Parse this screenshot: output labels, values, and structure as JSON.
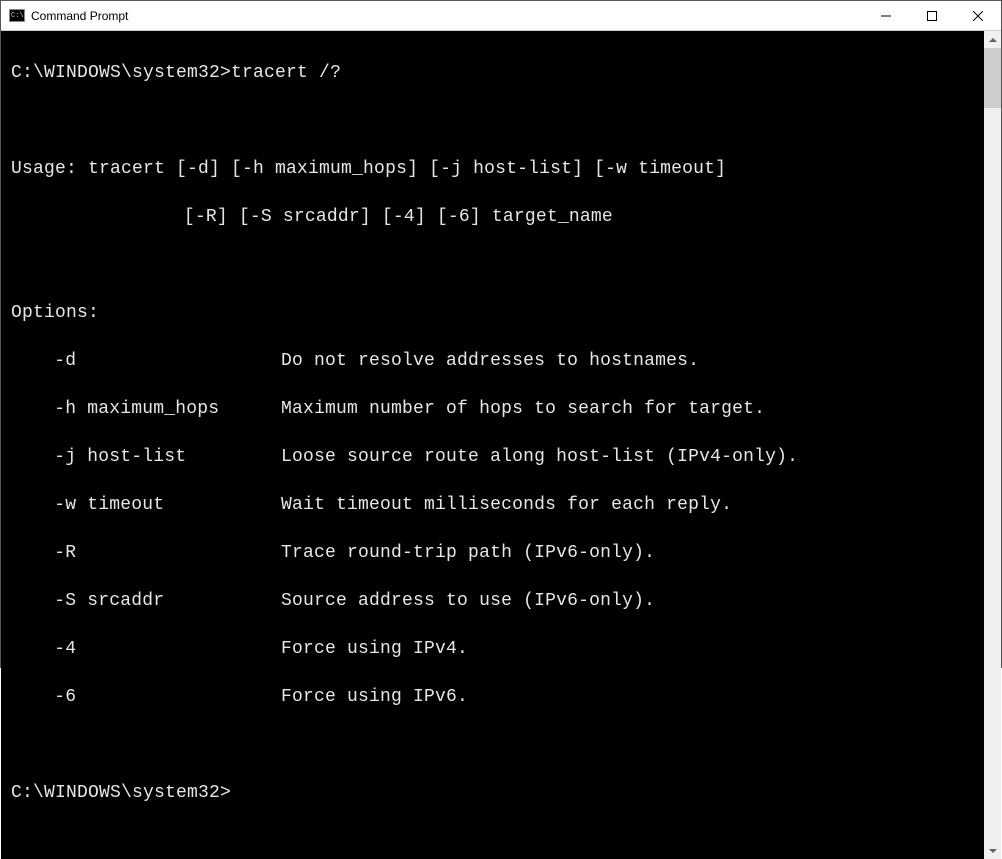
{
  "window": {
    "title": "Command Prompt"
  },
  "terminal": {
    "prompt1": "C:\\WINDOWS\\system32>",
    "command1": "tracert /?",
    "usage_label": "Usage: ",
    "usage_line1": "tracert [-d] [-h maximum_hops] [-j host-list] [-w timeout]",
    "usage_line2": "[-R] [-S srcaddr] [-4] [-6] target_name",
    "options_label": "Options:",
    "options": [
      {
        "flag": "-d",
        "desc": "Do not resolve addresses to hostnames."
      },
      {
        "flag": "-h maximum_hops",
        "desc": "Maximum number of hops to search for target."
      },
      {
        "flag": "-j host-list",
        "desc": "Loose source route along host-list (IPv4-only)."
      },
      {
        "flag": "-w timeout",
        "desc": "Wait timeout milliseconds for each reply."
      },
      {
        "flag": "-R",
        "desc": "Trace round-trip path (IPv6-only)."
      },
      {
        "flag": "-S srcaddr",
        "desc": "Source address to use (IPv6-only)."
      },
      {
        "flag": "-4",
        "desc": "Force using IPv4."
      },
      {
        "flag": "-6",
        "desc": "Force using IPv6."
      }
    ],
    "prompt2": "C:\\WINDOWS\\system32>"
  }
}
